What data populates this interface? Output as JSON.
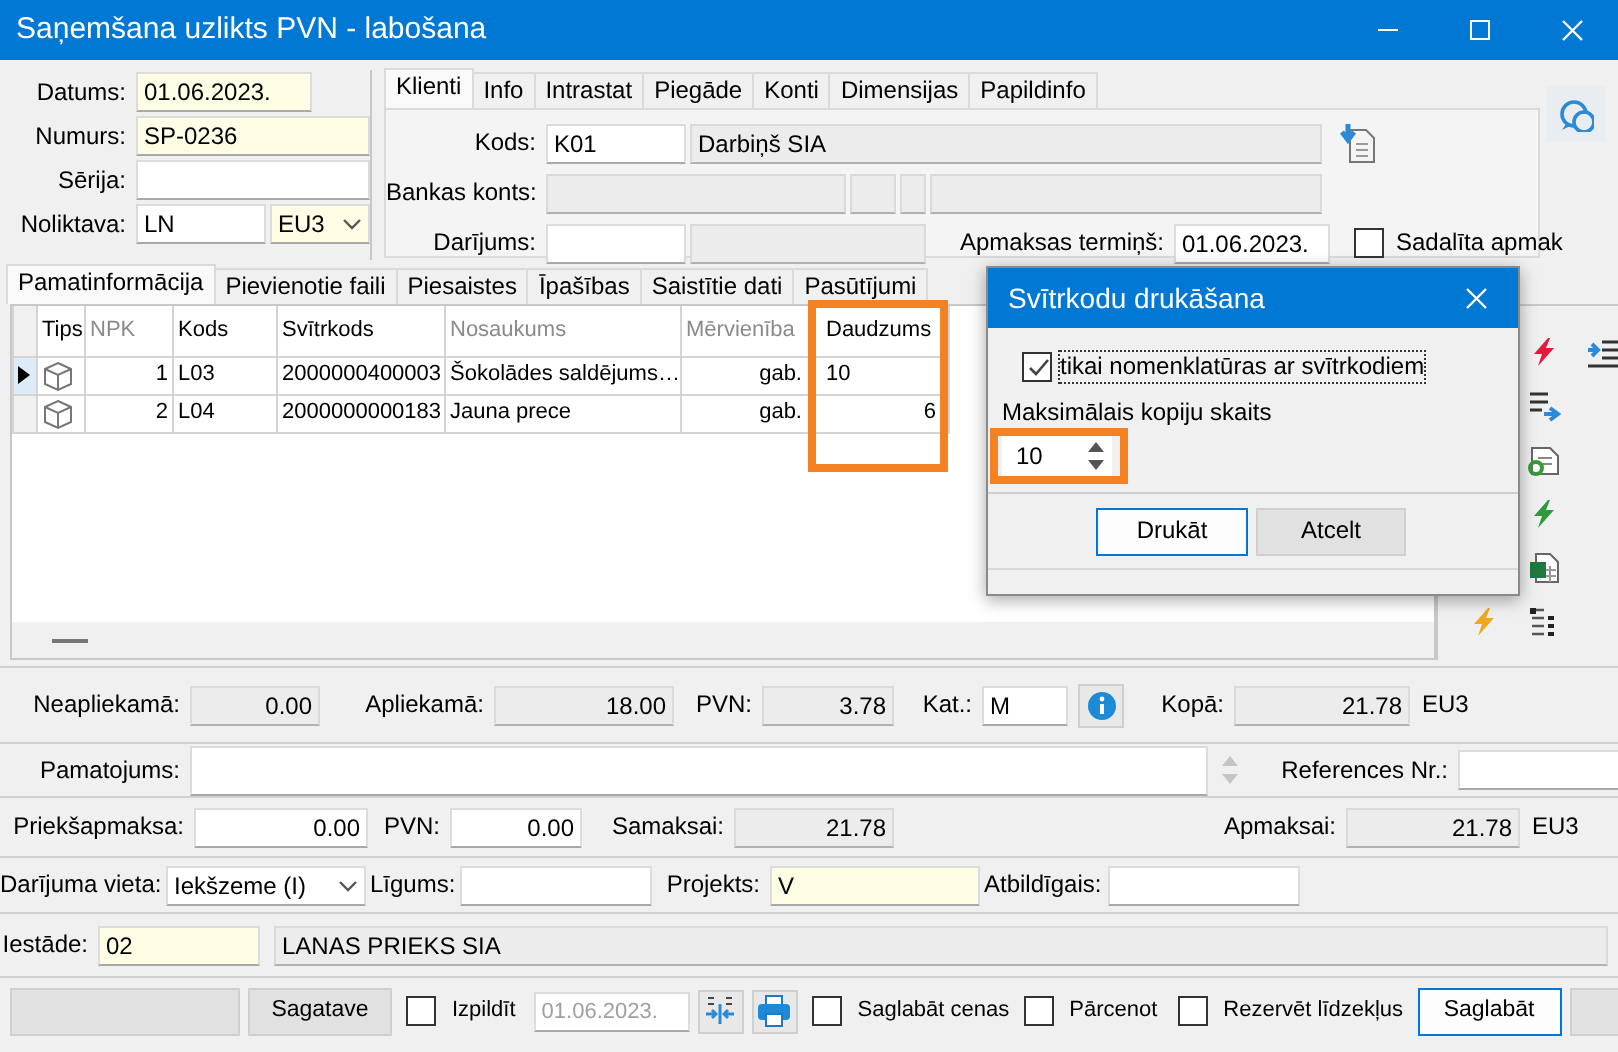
{
  "window": {
    "title": "Saņemšana uzlikts PVN - labošana"
  },
  "document": [
    {
      "label": "Datums:",
      "value": "01.06.2023.",
      "required": true
    },
    {
      "label": "Numurs:",
      "value": "SP-0236",
      "required": true
    },
    {
      "label": "Sērija:",
      "required": false
    },
    {
      "label": "Noliktava:",
      "value": "LN",
      "required": false,
      "currency": "EU3"
    }
  ],
  "partner_tabs": [
    {
      "label": "Klienti",
      "selected": true
    },
    {
      "label": "Info",
      "selected": false
    },
    {
      "label": "Intrastat",
      "selected": false
    },
    {
      "label": "Piegāde",
      "selected": false
    },
    {
      "label": "Konti",
      "selected": false
    },
    {
      "label": "Dimensijas",
      "selected": false
    },
    {
      "label": "Papildinfo",
      "selected": false
    }
  ],
  "partner": {
    "code_label": "Kods:",
    "code": "K01",
    "name": "Darbiņš SIA",
    "bank_label": "Bankas konts:",
    "deal_label": "Darījums:",
    "due_label": "Apmaksas termiņš:",
    "due": "01.06.2023.",
    "split": {
      "label": "Sadalīta apmak",
      "checked": false
    }
  },
  "item_tabs": [
    {
      "label": "Pamatinformācija",
      "selected": true
    },
    {
      "label": "Pievienotie faili",
      "selected": false
    },
    {
      "label": "Piesaistes",
      "selected": false
    },
    {
      "label": "Īpašības",
      "selected": false
    },
    {
      "label": "Saistītie dati",
      "selected": false
    },
    {
      "label": "Pasūtījumi",
      "selected": false
    }
  ],
  "grid": {
    "columns": [
      {
        "label": "Tips",
        "dimmed": false
      },
      {
        "label": "NPK",
        "dimmed": true
      },
      {
        "label": "Kods",
        "dimmed": false
      },
      {
        "label": "Svītrkods",
        "dimmed": false
      },
      {
        "label": "Nosaukums",
        "dimmed": true
      },
      {
        "label": "Mērvienība",
        "dimmed": true
      },
      {
        "label": "Daudzums",
        "dimmed": false
      }
    ],
    "rows": [
      {
        "selected": true,
        "cells": [
          "",
          "1",
          "L03",
          "2000000400003",
          "Šokolādes saldējums…",
          "gab.",
          "10"
        ]
      },
      {
        "selected": false,
        "cells": [
          "",
          "2",
          "L04",
          "2000000000183",
          "Jauna prece",
          "gab.",
          "6"
        ]
      }
    ]
  },
  "totals": [
    {
      "label": "Neapliekamā:",
      "value": "0.00",
      "kind": "readonly"
    },
    {
      "label": "Apliekamā:",
      "value": "18.00",
      "kind": "readonly"
    },
    {
      "label": "PVN:",
      "value": "3.78",
      "kind": "readonly"
    },
    {
      "label": "Kat.:",
      "value": "M",
      "kind": "input"
    },
    {
      "kind": "info"
    },
    {
      "label": "Kopā:",
      "value": "21.78",
      "kind": "readonly",
      "unit": "EU3"
    }
  ],
  "notes": [
    {
      "label": "Pamatojums:",
      "kind": "memo"
    },
    {
      "label": "References Nr.:",
      "kind": "input"
    }
  ],
  "payments": [
    {
      "label": "Priekšapmaksa:",
      "value": "0.00",
      "kind": "input"
    },
    {
      "label": "PVN:",
      "value": "0.00",
      "kind": "input"
    },
    {
      "label": "Samaksai:",
      "value": "21.78",
      "kind": "readonly"
    },
    {
      "label": "Apmaksai:",
      "value": "21.78",
      "kind": "readonly",
      "unit": "EU3"
    }
  ],
  "deal": [
    {
      "label": "Darījuma vieta:",
      "value": "Iekšzeme (I)",
      "kind": "combo"
    },
    {
      "label": "Līgums:",
      "kind": "input"
    },
    {
      "label": "Projekts:",
      "value": "V",
      "kind": "required"
    },
    {
      "label": "Atbildīgais:",
      "kind": "input"
    }
  ],
  "unit": [
    {
      "label": "Iestāde:",
      "value": "02",
      "kind": "required"
    },
    {
      "value": "LANAS PRIEKS SIA",
      "kind": "readonly"
    }
  ],
  "bottom_bar": [
    {
      "kind": "button"
    },
    {
      "kind": "button",
      "label": "Sagatave"
    },
    {
      "kind": "checkbox",
      "label": "Izpildīt",
      "checked": false
    },
    {
      "kind": "date",
      "value": "01.06.2023.",
      "disabled": true
    },
    {
      "kind": "split"
    },
    {
      "kind": "print"
    },
    {
      "kind": "checkbox",
      "label": "Saglabāt cenas",
      "checked": false
    },
    {
      "kind": "checkbox",
      "label": "Pārcenot",
      "checked": false
    },
    {
      "kind": "checkbox",
      "label": "Rezervēt līdzekļus",
      "checked": false
    },
    {
      "kind": "button",
      "label": "Saglabāt",
      "default": true
    },
    {
      "kind": "button"
    }
  ],
  "dialog": {
    "title": "Svītrkodu drukāšana",
    "option": {
      "label": "tikai nomenklatūras ar svītrkodiem",
      "checked": true
    },
    "copies_label": "Maksimālais kopiju skaits",
    "copies": "10",
    "buttons": [
      {
        "label": "Drukāt",
        "default": true
      },
      {
        "label": "Atcelt",
        "default": false
      }
    ]
  }
}
